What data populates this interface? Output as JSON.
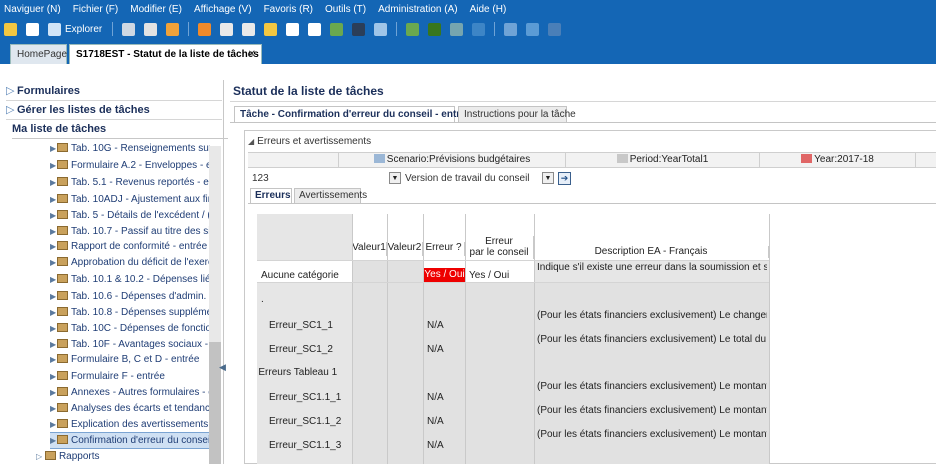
{
  "menubar": {
    "items": [
      "Naviguer (N)",
      "Fichier (F)",
      "Modifier (E)",
      "Affichage (V)",
      "Favoris (R)",
      "Outils (T)",
      "Administration (A)",
      "Aide (H)"
    ],
    "explorer_label": "Explorer",
    "color": "#1466b5"
  },
  "tabs": {
    "home": "HomePage",
    "active": "S1718EST - Statut de la liste de tâches",
    "close": "✕"
  },
  "left_panel": {
    "forms": "Formulaires",
    "manage_tasklists": "Gérer les listes de tâches",
    "my_tasklist": "Ma liste de tâches",
    "tasks": [
      "Tab. 10G - Renseignements supplé",
      "Formulaire A.2 - Enveloppes - entré",
      "Tab. 5.1 - Revenus reportés - entré",
      "Tab. 10ADJ - Ajustement aux fins d",
      "Tab. 5 - Détails de l'excédent / (défi",
      "Tab. 10.7 - Passif au titre des sites",
      "Rapport de conformité - entrée",
      "Approbation du déficit de l'exercice",
      "Tab. 10.1 & 10.2 - Dépenses liées a",
      "Tab. 10.6 - Dépenses d'admin. du c",
      "Tab. 10.8 - Dépenses supplémentai",
      "Tab. 10C - Dépenses de fonctionne",
      "Tab. 10F - Avantages sociaux - entr",
      "Formulaire B, C et D - entrée",
      "Formulaire F - entrée",
      "Annexes - Autres formulaires - entr",
      "Analyses des écarts et tendances -",
      "Explication des avertissements - en",
      "Confirmation d'erreur du consei"
    ],
    "reports": "Rapports"
  },
  "main": {
    "title": "Statut de la liste de tâches",
    "subtab_task": "Tâche - Confirmation d'erreur du conseil - entrée",
    "subtab_instructions": "Instructions pour la tâche",
    "section_title": "Erreurs et avertissements",
    "pov": {
      "scenario": "Scenario:Prévisions budgétaires",
      "period": "Period:YearTotal1",
      "year": "Year:2017-18",
      "entity": "123",
      "version": "Version de travail du conseil"
    },
    "inner_tabs": {
      "errors": "Erreurs",
      "warnings": "Avertissements"
    },
    "grid": {
      "headers": {
        "valeur1": "Valeur1",
        "valeur2": "Valeur2",
        "erreur": "Erreur ?",
        "acceptee_1": "Erreur acceptée",
        "acceptee_2": "par le conseil",
        "description": "Description EA - Français"
      },
      "rows": [
        {
          "label": "Aucune catégorie",
          "erreur": "Yes / Oui",
          "acceptee": "Yes / Oui",
          "desc": "Indique s'il existe une erreur dans la soumission et si le p"
        },
        {
          "label": ".",
          "erreur": "",
          "acceptee": "",
          "desc": ""
        },
        {
          "label": "Erreur_SC1_1",
          "erreur": "N/A",
          "acceptee": "",
          "desc": "(Pour les états financiers exclusivement) Le changement"
        },
        {
          "label": "Erreur_SC1_2",
          "erreur": "N/A",
          "acceptee": "",
          "desc": "(Pour les états financiers exclusivement) Le total du sold"
        },
        {
          "label": "Erreurs Tableau 1",
          "erreur": "",
          "acceptee": "",
          "desc": ""
        },
        {
          "label": "Erreur_SC1.1_1",
          "erreur": "N/A",
          "acceptee": "",
          "desc": "(Pour les états financiers exclusivement) Le montant de l"
        },
        {
          "label": "Erreur_SC1.1_2",
          "erreur": "N/A",
          "acceptee": "",
          "desc": "(Pour les états financiers exclusivement) Le montant de l"
        },
        {
          "label": "Erreur_SC1.1_3",
          "erreur": "N/A",
          "acceptee": "",
          "desc": "(Pour les états financiers exclusivement) Le montant de l"
        }
      ],
      "error_color": "#ee0000"
    }
  }
}
